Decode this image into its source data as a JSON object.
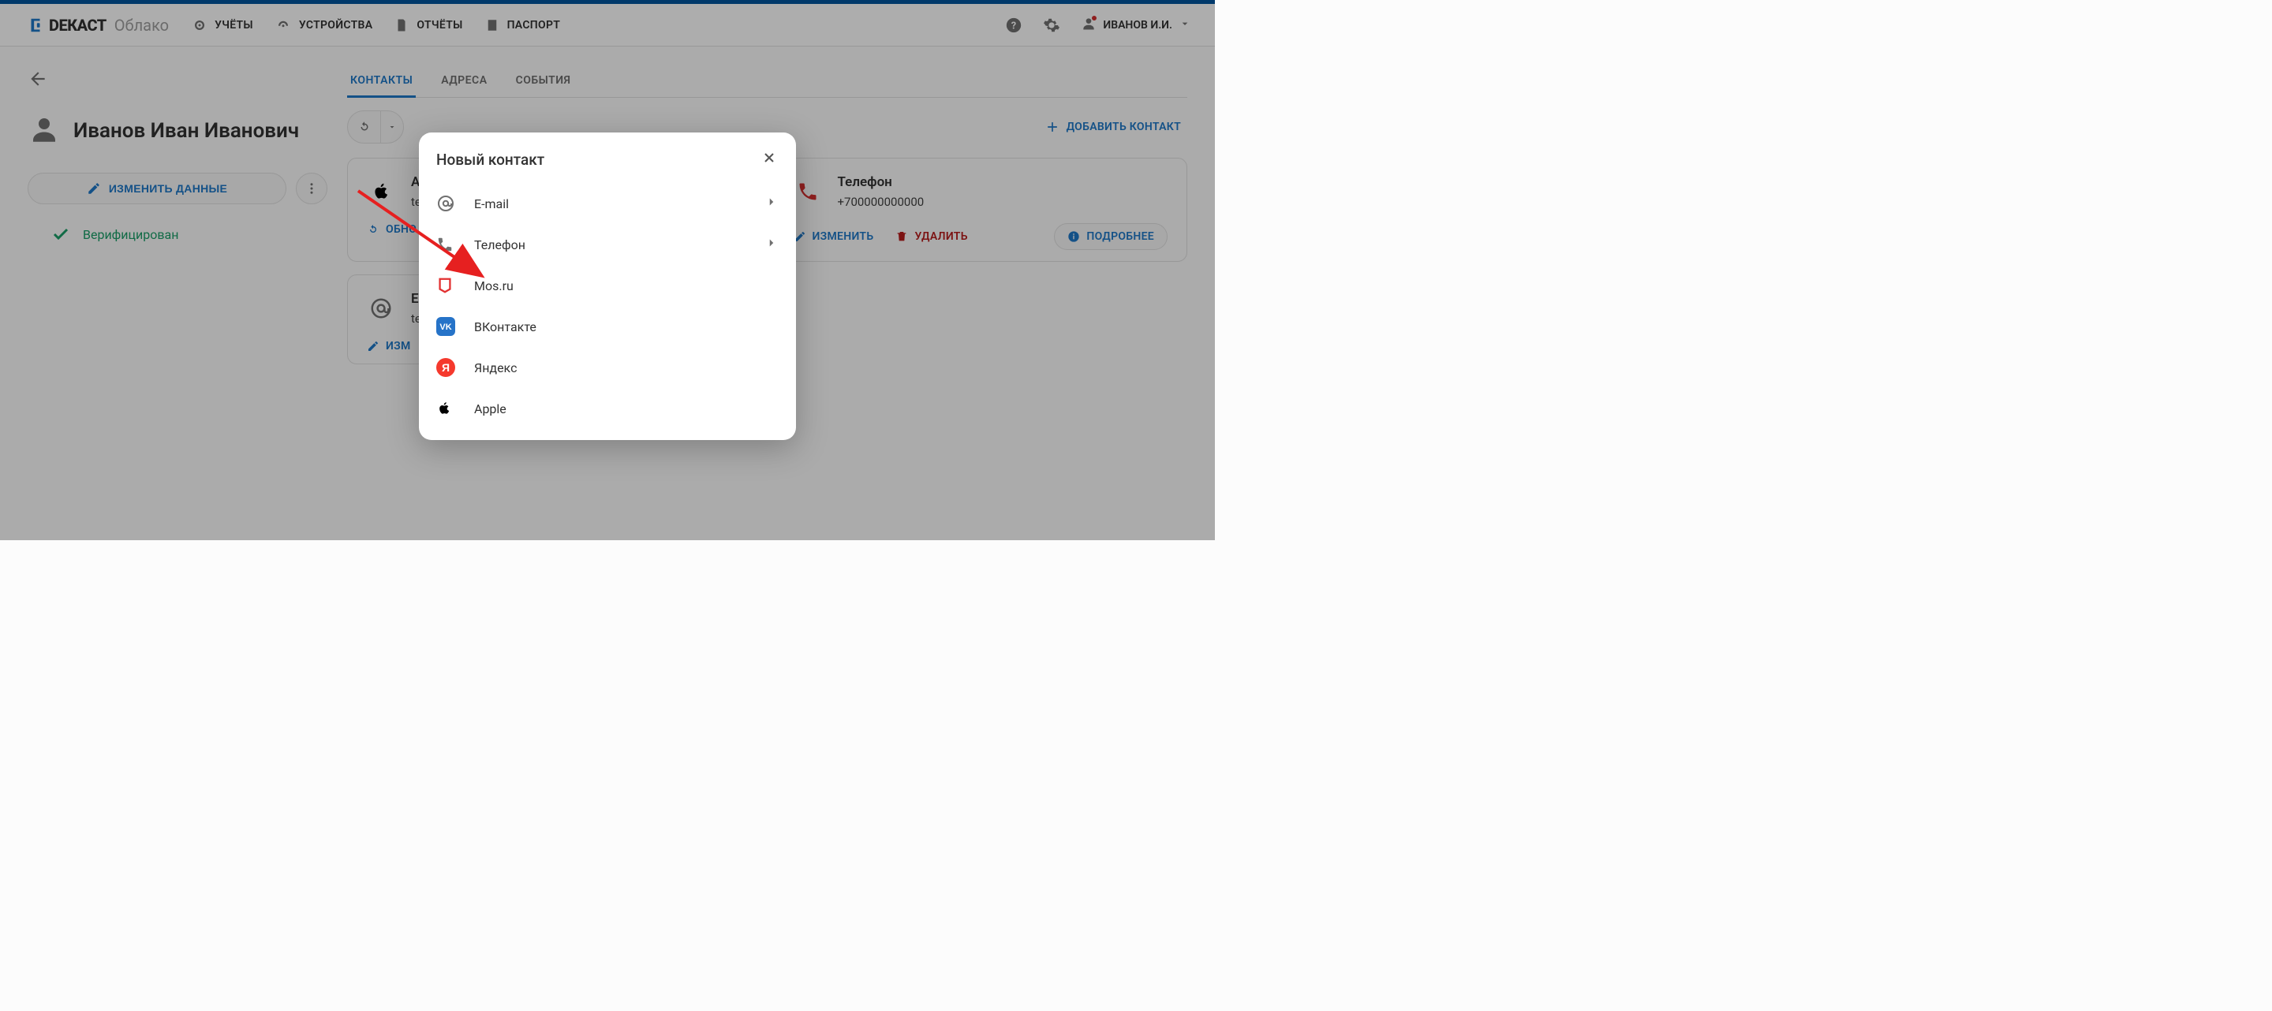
{
  "brand": {
    "main": "DЕКАСТ",
    "sub": "Облако"
  },
  "nav": {
    "accounts": "УЧЁТЫ",
    "devices": "УСТРОЙСТВА",
    "reports": "ОТЧЁТЫ",
    "passport": "ПАСПОРТ"
  },
  "user": {
    "name": "ИВАНОВ И.И."
  },
  "left": {
    "person_name": "Иванов Иван Иванович",
    "edit_button": "ИЗМЕНИТЬ ДАННЫЕ",
    "verified": "Верифицирован"
  },
  "tabs": {
    "contacts": "КОНТАКТЫ",
    "addresses": "АДРЕСА",
    "events": "СОБЫТИЯ"
  },
  "toolbar": {
    "add_contact": "ДОБАВИТЬ КОНТАКТ"
  },
  "cards": {
    "apple": {
      "title": "A",
      "sub": "te",
      "refresh_token": "ОБНО",
      "edit": "ИЗМ"
    },
    "phone": {
      "title": "Телефон",
      "sub": "+700000000000",
      "edit": "ИЗМЕНИТЬ",
      "delete": "УДАЛИТЬ",
      "details": "ПОДРОБНЕЕ"
    },
    "email": {
      "title": "E-",
      "sub": "te"
    }
  },
  "modal": {
    "title": "Новый контакт",
    "items": {
      "email": "E-mail",
      "phone": "Телефон",
      "mosru": "Mos.ru",
      "vk": "ВКонтакте",
      "yandex": "Яндекс",
      "apple": "Apple"
    }
  },
  "colors": {
    "primary": "#1E78C8",
    "danger": "#b71c1c",
    "success": "#1a9e68",
    "vk": "#2673c8",
    "yandex": "#f5392d",
    "mosru": "#e23030"
  }
}
